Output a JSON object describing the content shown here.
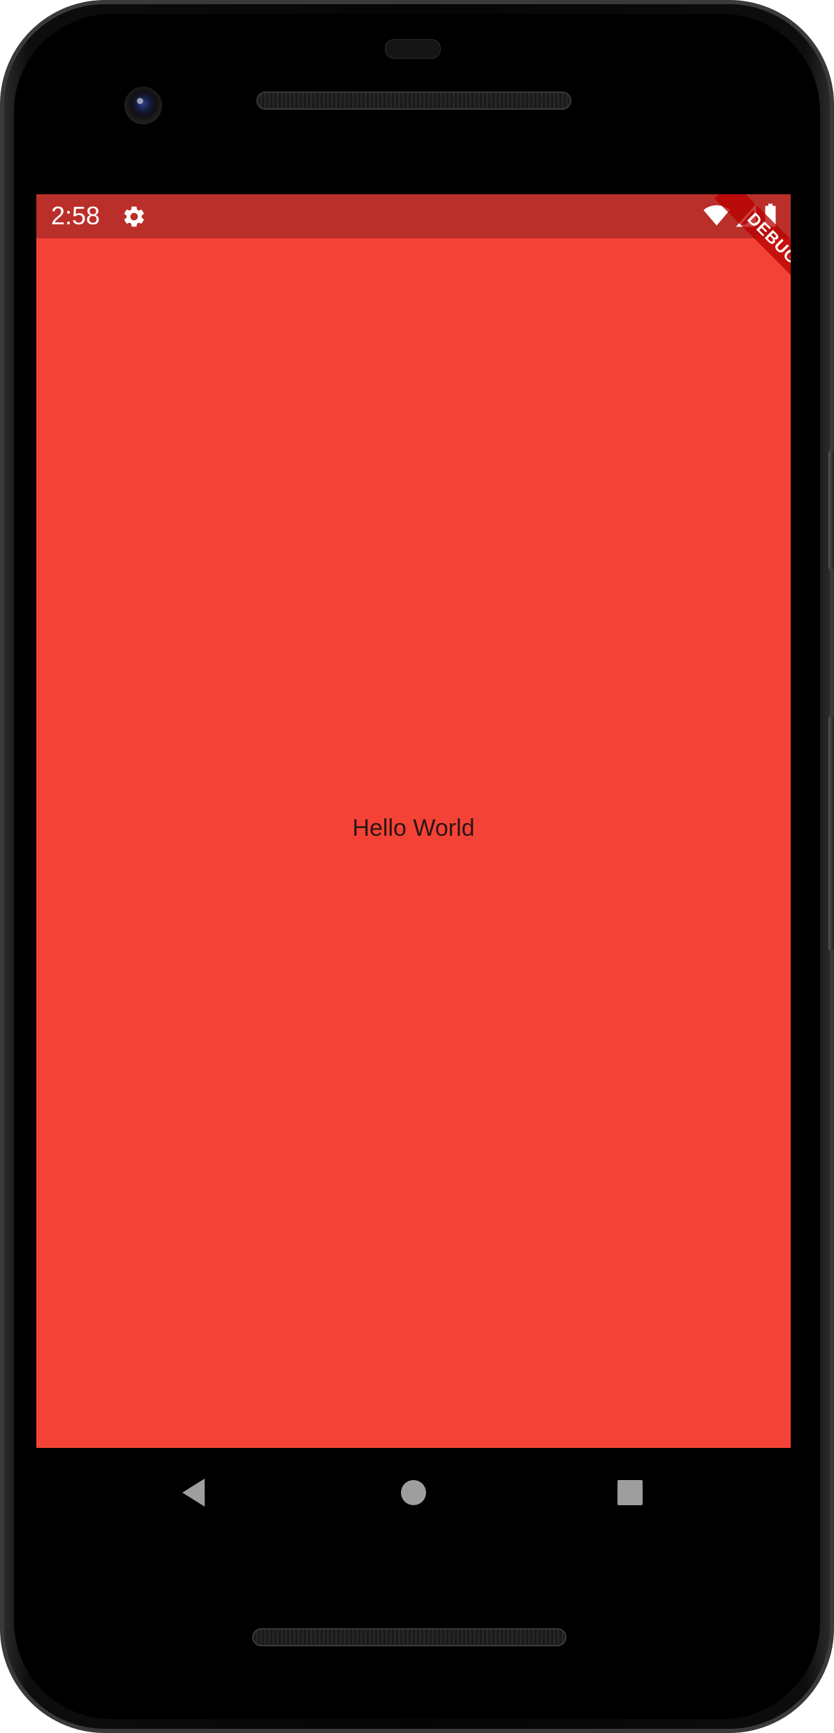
{
  "status_bar": {
    "time": "2:58",
    "left_icons": [
      "settings-gear-icon"
    ],
    "right_icons": [
      "wifi-icon",
      "cellular-signal-icon",
      "battery-icon"
    ],
    "color": "#ba2f2a"
  },
  "debug_banner": {
    "label": "DEBUG"
  },
  "app": {
    "background_color": "#f44336",
    "center_text": "Hello World"
  },
  "navigation_bar": {
    "buttons": [
      "back-icon",
      "home-icon",
      "recents-icon"
    ]
  }
}
